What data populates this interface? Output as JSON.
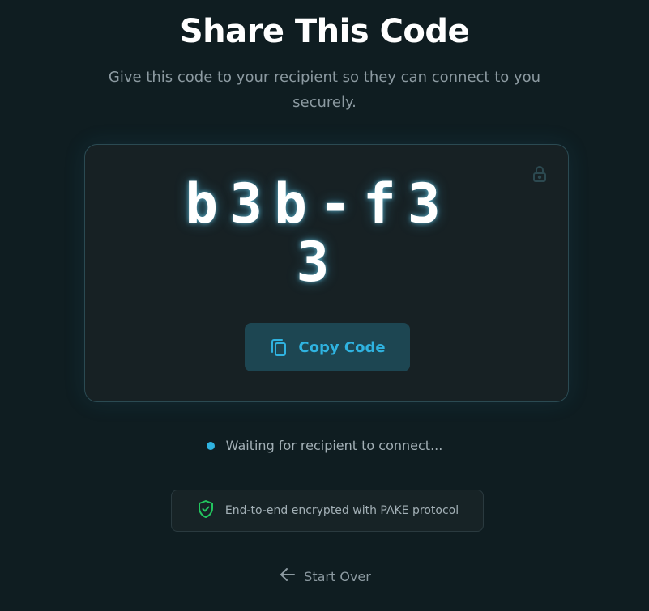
{
  "header": {
    "title": "Share This Code",
    "subtitle": "Give this code to your recipient so they can connect to you securely."
  },
  "code_card": {
    "code": "b3b-f33",
    "copy_label": "Copy Code",
    "lock_icon": "lock-icon",
    "copy_icon": "copy-icon"
  },
  "status": {
    "text": "Waiting for recipient to connect...",
    "dot_color": "#2fb3e0"
  },
  "security": {
    "text": "End-to-end encrypted with PAKE protocol",
    "icon": "shield-check-icon",
    "icon_color": "#22c55e"
  },
  "footer": {
    "start_over_label": "Start Over",
    "icon": "arrow-left-icon"
  },
  "colors": {
    "background": "#0f1d21",
    "accent": "#2fb3e0",
    "card_border": "#2b4a52"
  }
}
